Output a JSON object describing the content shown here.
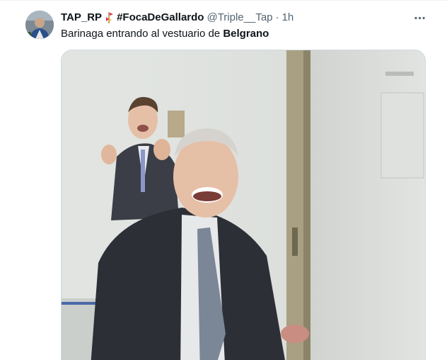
{
  "tweet": {
    "display_name": "TAP_RP",
    "flag_icon": "river-plate-flag-icon",
    "hashtag": "#FocaDeGallardo",
    "handle": "@Triple__Tap",
    "separator": "·",
    "time": "1h",
    "text_prefix": "Barinaga entrando al vestuario de ",
    "text_bold": "Belgrano",
    "more_icon": "more-options-icon",
    "media": {
      "type": "video-frame"
    }
  },
  "colors": {
    "text_primary": "#0f1419",
    "text_secondary": "#536471",
    "border": "#cfd9de"
  }
}
